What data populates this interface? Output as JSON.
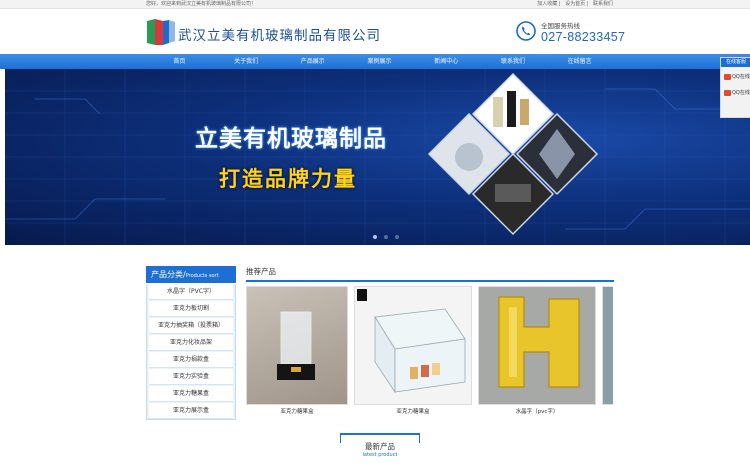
{
  "topbar": {
    "welcome": "您好，欢迎来到武汉立美有机玻璃制品有限公司！",
    "links": [
      "加入收藏",
      "设为首页",
      "联系我们"
    ]
  },
  "header": {
    "company_name": "武汉立美有机玻璃制品有限公司",
    "hotline_label": "全国服务热线",
    "hotline_number": "027-88233457"
  },
  "nav": {
    "items": [
      "首页",
      "关于我们",
      "产品展示",
      "案例展示",
      "新闻中心",
      "联系我们",
      "在线留言"
    ]
  },
  "banner": {
    "headline": "立美有机玻璃制品",
    "subline": "打造品牌力量",
    "slides": 3,
    "active_slide": 1
  },
  "side_qq": {
    "title": "在线客服",
    "items": [
      "QQ在线",
      "QQ在线"
    ]
  },
  "sidebar": {
    "title": "产品分类/",
    "title_en": "Products sort",
    "items": [
      "水晶字（PVC字）",
      "亚克力板切割",
      "亚克力抽奖箱（投票箱）",
      "亚克力化妆品架",
      "亚克力捐款盒",
      "亚克力实验盒",
      "亚克力糖果盒",
      "亚克力展示盒"
    ]
  },
  "products": {
    "title": "推荐产品",
    "items": [
      {
        "caption": "亚克力糖果盒"
      },
      {
        "caption": "亚克力糖果盒"
      },
      {
        "caption": "水晶字（pvc字）"
      }
    ]
  },
  "latest": {
    "title": "最新产品",
    "subtitle": "latest product"
  },
  "colors": {
    "brand_blue": "#1d6fd4",
    "company_text": "#1a4f9a",
    "slogan_yellow": "#ffd21a"
  }
}
